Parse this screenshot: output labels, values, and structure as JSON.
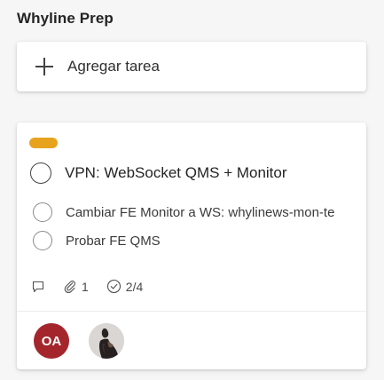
{
  "bucket": {
    "title": "Whyline Prep"
  },
  "add_task": {
    "label": "Agregar tarea",
    "icon": "plus-icon"
  },
  "card": {
    "label_color": "#e8a31e",
    "title": "VPN: WebSocket QMS + Monitor",
    "checklist": [
      {
        "text": "Cambiar FE Monitor a WS: whylinews-mon-te"
      },
      {
        "text": "Probar FE QMS"
      }
    ],
    "meta": {
      "comments_icon": "comment-icon",
      "attachments_icon": "paperclip-icon",
      "attachments_count": "1",
      "checklist_icon": "checklist-check-icon",
      "checklist_progress": "2/4"
    },
    "assignees": [
      {
        "initials": "OA",
        "color": "#a4262c",
        "type": "initials"
      },
      {
        "type": "photo",
        "icon": "person-photo-avatar"
      }
    ]
  }
}
